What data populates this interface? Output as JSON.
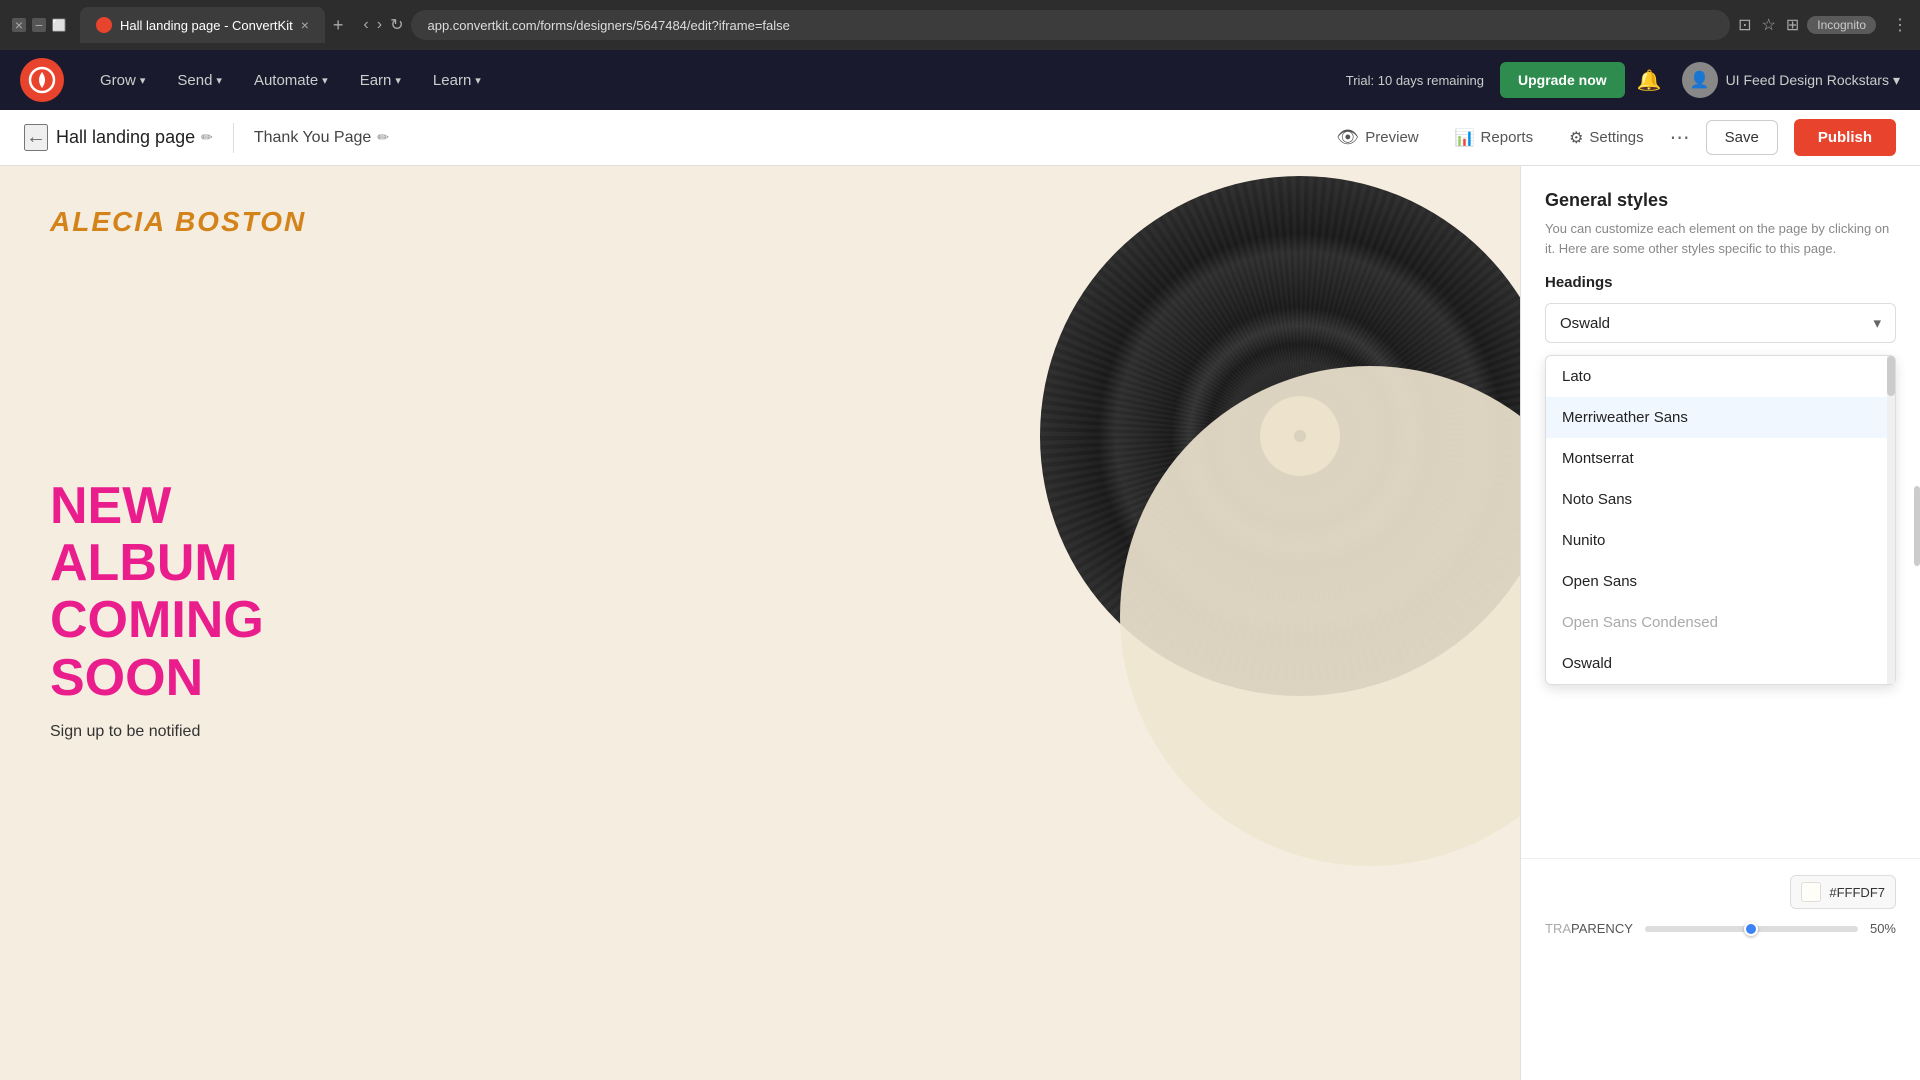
{
  "browser": {
    "tab_title": "Hall landing page - ConvertKit",
    "url": "app.convertkit.com/forms/designers/5647484/edit?iframe=false",
    "new_tab_label": "+",
    "incognito_label": "Incognito"
  },
  "topnav": {
    "grow_label": "Grow",
    "send_label": "Send",
    "automate_label": "Automate",
    "earn_label": "Earn",
    "learn_label": "Learn",
    "trial_label": "Trial: 10 days remaining",
    "upgrade_label": "Upgrade now",
    "user_label": "UI Feed Design Rockstars"
  },
  "editor_bar": {
    "page_title": "Hall landing page",
    "thank_you_tab": "Thank You Page",
    "preview_label": "Preview",
    "reports_label": "Reports",
    "settings_label": "Settings",
    "save_label": "Save",
    "publish_label": "Publish"
  },
  "canvas": {
    "brand_name": "ALECIA BOSTON",
    "headline_line1": "NEW",
    "headline_line2": "ALBUM",
    "headline_line3": "COMING",
    "headline_line4": "SOON",
    "sub_text": "Sign up to be notified"
  },
  "right_panel": {
    "title": "General styles",
    "description": "You can customize each element on the page by clicking on it. Here are some other styles specific to this page.",
    "headings_label": "Headings",
    "selected_font": "Oswald",
    "dropdown_fonts": [
      {
        "name": "Lato",
        "grayed": false
      },
      {
        "name": "Merriweather Sans",
        "grayed": false,
        "highlighted": true
      },
      {
        "name": "Montserrat",
        "grayed": false
      },
      {
        "name": "Noto Sans",
        "grayed": false
      },
      {
        "name": "Nunito",
        "grayed": false
      },
      {
        "name": "Open Sans",
        "grayed": false
      },
      {
        "name": "Open Sans Condensed",
        "grayed": true
      },
      {
        "name": "Oswald",
        "grayed": false
      }
    ],
    "color_label": "",
    "color_hex": "#FFFDF7",
    "transparency_label": "PARENCY",
    "transparency_value": "50%",
    "slider_percent": 50
  }
}
